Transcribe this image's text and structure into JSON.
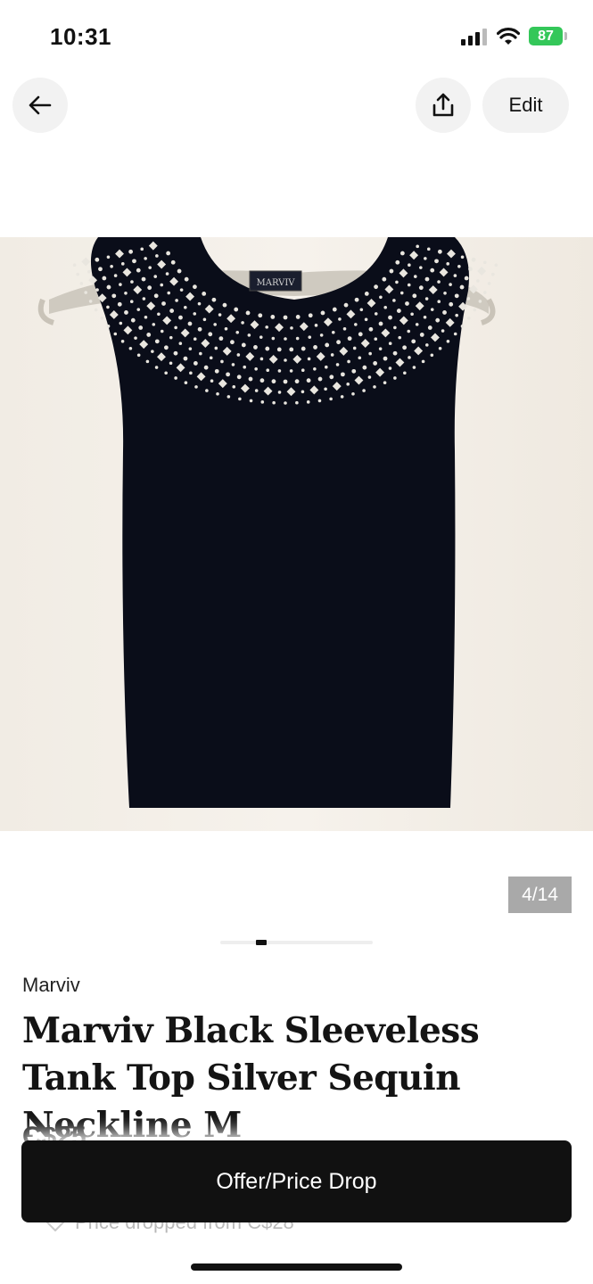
{
  "status_bar": {
    "time": "10:31",
    "battery": "87"
  },
  "header": {
    "edit_label": "Edit"
  },
  "photo": {
    "label_text": "MARVIV",
    "counter": "4/14"
  },
  "pager": {
    "current_fraction": 0.27
  },
  "listing": {
    "brand": "Marviv",
    "title": "Marviv Black Sleeveless Tank Top Silver Sequin Neckline M",
    "price": "C$25",
    "price_dropped_text": "Price dropped from C$28"
  },
  "action": {
    "offer_label": "Offer/Price Drop"
  },
  "colors": {
    "primary_button": "#111111",
    "battery": "#34c759",
    "counter_bg": "#a9a9a9"
  }
}
